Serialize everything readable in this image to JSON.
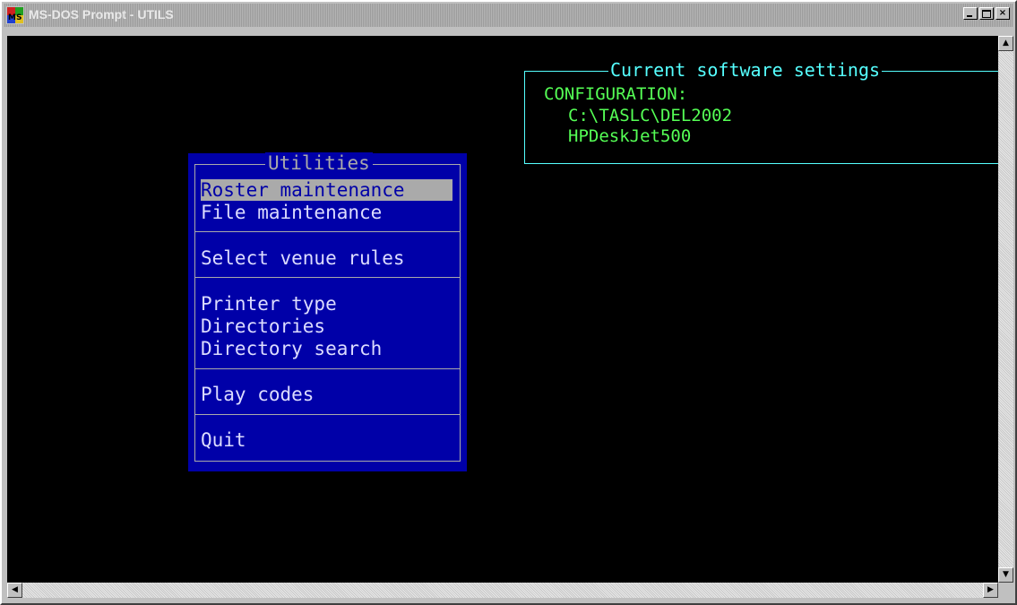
{
  "window": {
    "title": "MS-DOS Prompt - UTILS",
    "app_icon": "ms-dos-icon",
    "buttons": {
      "minimize": "minimize-icon",
      "maximize": "maximize-icon",
      "close_label": "×"
    }
  },
  "settings": {
    "title": "Current software settings",
    "lines": [
      "CONFIGURATION:",
      "C:\\TASLC\\DEL2002",
      "HPDeskJet500"
    ]
  },
  "menu": {
    "title": "Utilities",
    "groups": [
      [
        "Roster maintenance",
        "File maintenance"
      ],
      [
        "Select venue rules"
      ],
      [
        "Printer type",
        "Directories",
        "Directory search"
      ],
      [
        "Play codes"
      ],
      [
        "Quit"
      ]
    ],
    "selected": "Roster maintenance"
  },
  "scrollbar": {
    "up_arrow": "▲",
    "down_arrow": "▼",
    "left_arrow": "◀",
    "right_arrow": "▶"
  },
  "colors": {
    "screen": "#000000",
    "menu_bg": "#0000a8",
    "menu_text": "#dcdcff",
    "menu_highlight": "#aaaaaa",
    "settings_border": "#55ffff",
    "settings_text": "#55ff55"
  }
}
